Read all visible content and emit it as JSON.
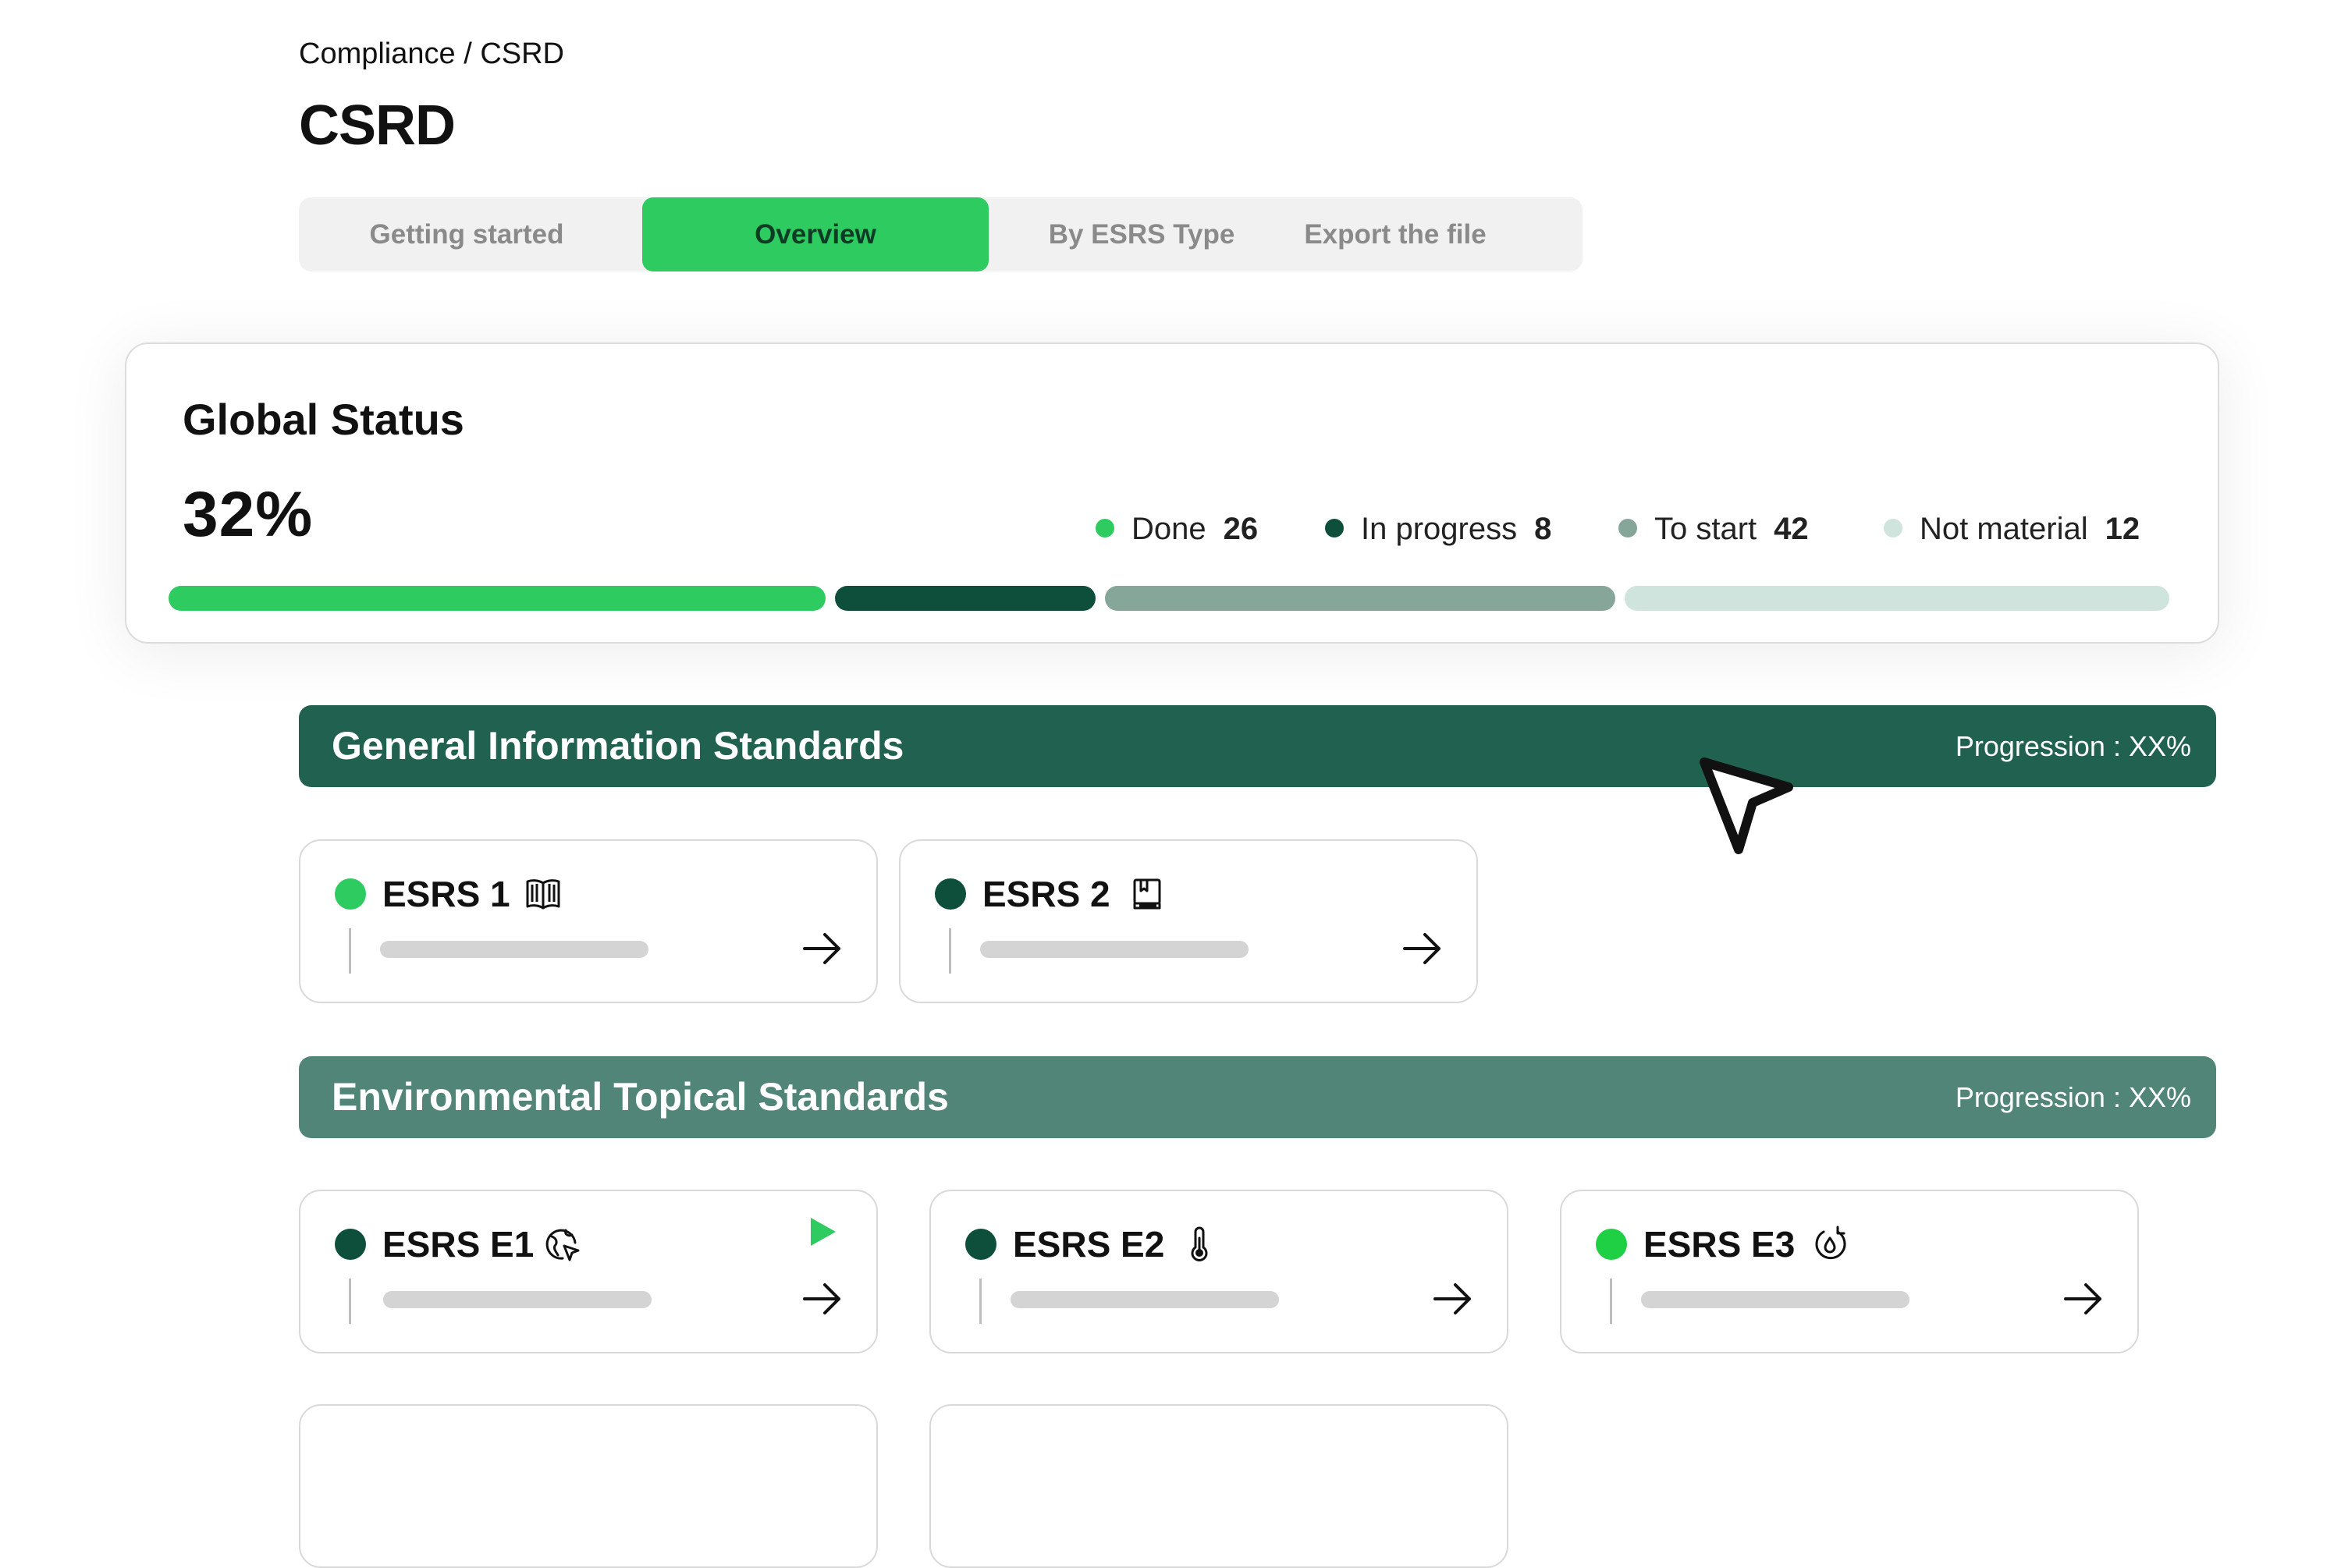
{
  "breadcrumb": "Compliance / CSRD",
  "page_title": "CSRD",
  "tabs": [
    {
      "label": "Getting started",
      "active": false
    },
    {
      "label": "Overview",
      "active": true
    },
    {
      "label": "By ESRS Type",
      "active": false
    },
    {
      "label": "Export the file",
      "active": false
    }
  ],
  "global_status": {
    "title": "Global Status",
    "percent": "32%",
    "legend": [
      {
        "label": "Done",
        "count": "26",
        "color": "#2ecc60"
      },
      {
        "label": "In progress",
        "count": "8",
        "color": "#0d4f3a"
      },
      {
        "label": "To start",
        "count": "42",
        "color": "#86a69a"
      },
      {
        "label": "Not material",
        "count": "12",
        "color": "#cfe4dc"
      }
    ]
  },
  "sections": [
    {
      "title": "General Information Standards",
      "progression": "Progression : XX%",
      "color": "#206150",
      "cards": [
        {
          "name": "ESRS 1",
          "icon": "open-book-icon",
          "status_color": "#2ecc60",
          "play": false
        },
        {
          "name": "ESRS 2",
          "icon": "closed-book-icon",
          "status_color": "#0d4f3a",
          "play": false
        }
      ]
    },
    {
      "title": "Environmental Topical Standards",
      "progression": "Progression : XX%",
      "color": "#508578",
      "cards": [
        {
          "name": "ESRS E1",
          "icon": "globe-cursor-icon",
          "status_color": "#0d4f3a",
          "play": true
        },
        {
          "name": "ESRS E2",
          "icon": "thermometer-icon",
          "status_color": "#0d4f3a",
          "play": false
        },
        {
          "name": "ESRS E3",
          "icon": "water-cycle-icon",
          "status_color": "#1fd044",
          "play": false
        }
      ]
    }
  ]
}
